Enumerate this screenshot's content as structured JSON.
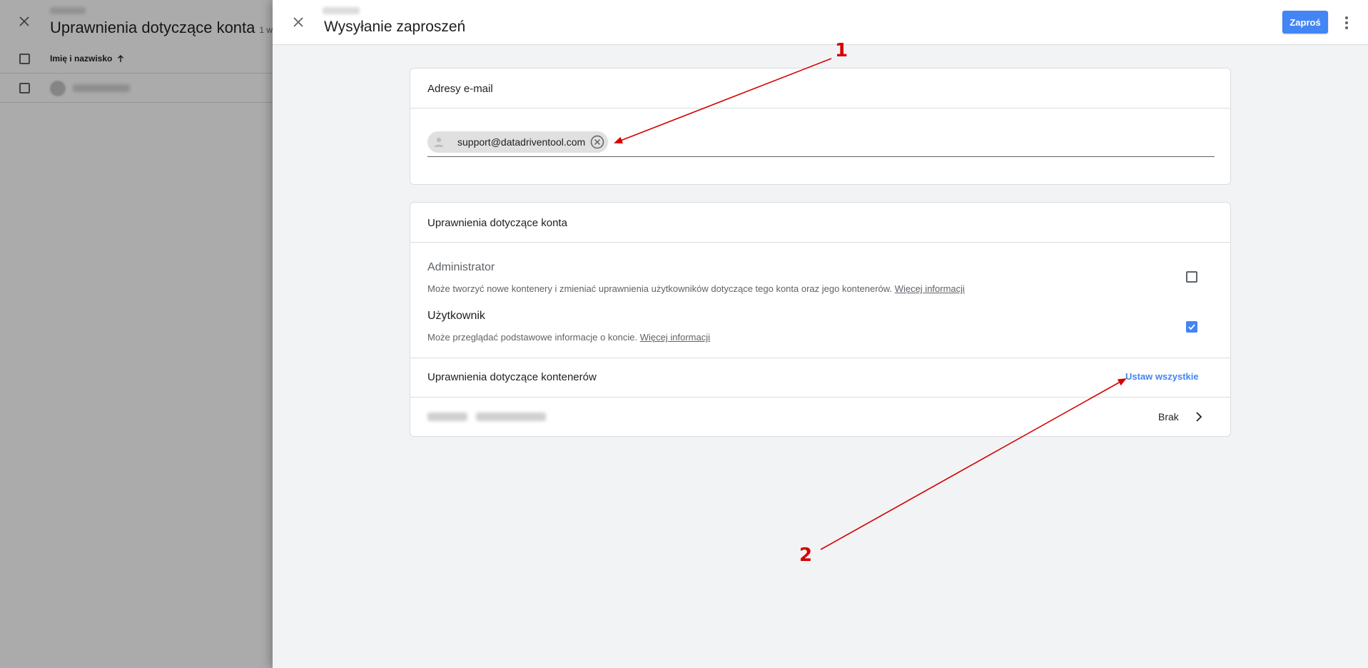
{
  "background": {
    "title": "Uprawnienia dotyczące konta",
    "title_count": "1 w",
    "column_name_header": "Imię i nazwisko"
  },
  "dialog": {
    "title": "Wysyłanie zaproszeń",
    "invite_label": "Zaproś",
    "email_section": {
      "heading": "Adresy e-mail",
      "chips": [
        "support@datadriventool.com"
      ]
    },
    "account_permissions": {
      "heading": "Uprawnienia dotyczące konta",
      "roles": [
        {
          "title": "Administrator",
          "description": "Może tworzyć nowe kontenery i zmieniać uprawnienia użytkowników dotyczące tego konta oraz jego kontenerów.",
          "link": "Więcej informacji",
          "checked": false
        },
        {
          "title": "Użytkownik",
          "description": "Może przeglądać podstawowe informacje o koncie.",
          "link": "Więcej informacji",
          "checked": true
        }
      ]
    },
    "container_permissions": {
      "heading": "Uprawnienia dotyczące kontenerów",
      "set_all_label": "Ustaw wszystkie",
      "rows": [
        {
          "value": "Brak"
        }
      ]
    }
  },
  "annotations": [
    "1",
    "2"
  ],
  "colors": {
    "accent": "#4285f4",
    "annotation": "#d50000"
  },
  "icons": {
    "close": "close-icon",
    "more": "more-vert-icon",
    "chip_remove": "cancel-circle-icon",
    "chevron": "chevron-right-icon",
    "sort": "arrow-up-icon",
    "avatar": "person-icon"
  }
}
